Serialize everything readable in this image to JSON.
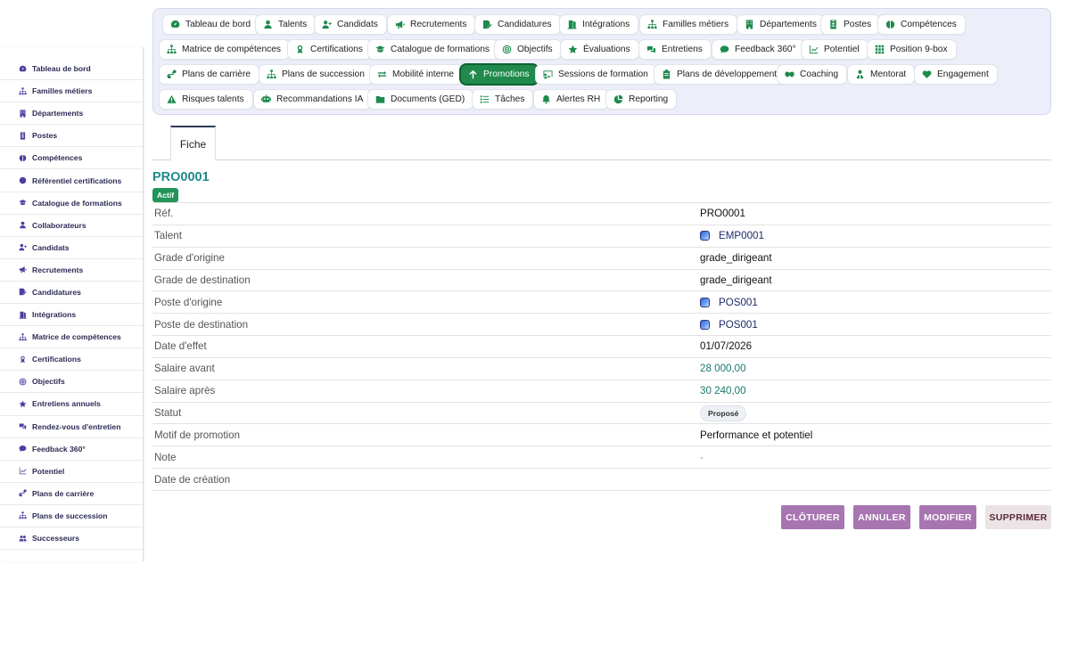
{
  "sidebar": {
    "items": [
      {
        "label": "Tableau de bord",
        "icon": "dashboard-icon"
      },
      {
        "label": "Familles métiers",
        "icon": "sitemap-icon"
      },
      {
        "label": "Départements",
        "icon": "building-icon"
      },
      {
        "label": "Postes",
        "icon": "id-badge-icon"
      },
      {
        "label": "Compétences",
        "icon": "brain-icon"
      },
      {
        "label": "Référentiel certifications",
        "icon": "certificate-icon"
      },
      {
        "label": "Catalogue de formations",
        "icon": "graduation-cap-icon"
      },
      {
        "label": "Collaborateurs",
        "icon": "user-icon"
      },
      {
        "label": "Candidats",
        "icon": "user-plus-icon"
      },
      {
        "label": "Recrutements",
        "icon": "megaphone-icon"
      },
      {
        "label": "Candidatures",
        "icon": "file-signature-icon"
      },
      {
        "label": "Intégrations",
        "icon": "door-icon"
      },
      {
        "label": "Matrice de compétences",
        "icon": "sitemap-icon"
      },
      {
        "label": "Certifications",
        "icon": "award-icon"
      },
      {
        "label": "Objectifs",
        "icon": "target-icon"
      },
      {
        "label": "Entretiens annuels",
        "icon": "star-icon"
      },
      {
        "label": "Rendez-vous d'entretien",
        "icon": "comments-icon"
      },
      {
        "label": "Feedback 360°",
        "icon": "comment-icon"
      },
      {
        "label": "Potentiel",
        "icon": "chart-line-icon"
      },
      {
        "label": "Plans de carrière",
        "icon": "route-icon"
      },
      {
        "label": "Plans de succession",
        "icon": "sitemap-icon"
      },
      {
        "label": "Successeurs",
        "icon": "users-icon"
      }
    ]
  },
  "topnav": {
    "chips": [
      {
        "label": "Tableau de bord",
        "icon": "dashboard-icon"
      },
      {
        "label": "Talents",
        "icon": "user-icon"
      },
      {
        "label": "Candidats",
        "icon": "user-plus-icon"
      },
      {
        "label": "Recrutements",
        "icon": "megaphone-icon"
      },
      {
        "label": "Candidatures",
        "icon": "file-signature-icon"
      },
      {
        "label": "Intégrations",
        "icon": "door-icon"
      },
      {
        "label": "Familles métiers",
        "icon": "sitemap-icon"
      },
      {
        "label": "Départements",
        "icon": "building-icon"
      },
      {
        "label": "Postes",
        "icon": "id-badge-icon"
      },
      {
        "label": "Compétences",
        "icon": "brain-icon"
      },
      {
        "label": "Matrice de compétences",
        "icon": "sitemap-icon"
      },
      {
        "label": "Certifications",
        "icon": "award-icon"
      },
      {
        "label": "Catalogue de formations",
        "icon": "graduation-cap-icon"
      },
      {
        "label": "Objectifs",
        "icon": "target-icon"
      },
      {
        "label": "Évaluations",
        "icon": "star-icon"
      },
      {
        "label": "Entretiens",
        "icon": "comments-icon"
      },
      {
        "label": "Feedback 360°",
        "icon": "comment-icon"
      },
      {
        "label": "Potentiel",
        "icon": "chart-line-icon"
      },
      {
        "label": "Position 9-box",
        "icon": "grid-icon"
      },
      {
        "label": "Plans de carrière",
        "icon": "route-icon"
      },
      {
        "label": "Plans de succession",
        "icon": "sitemap-icon"
      },
      {
        "label": "Mobilité interne",
        "icon": "exchange-icon"
      },
      {
        "label": "Promotions",
        "icon": "arrow-up-icon",
        "active": true
      },
      {
        "label": "Sessions de formation",
        "icon": "chalkboard-icon"
      },
      {
        "label": "Plans de développement",
        "icon": "clipboard-icon"
      },
      {
        "label": "Coaching",
        "icon": "handshake-icon"
      },
      {
        "label": "Mentorat",
        "icon": "mentor-icon"
      },
      {
        "label": "Engagement",
        "icon": "heart-icon"
      },
      {
        "label": "Risques talents",
        "icon": "warning-icon"
      },
      {
        "label": "Recommandations IA",
        "icon": "robot-icon"
      },
      {
        "label": "Documents (GED)",
        "icon": "folder-icon"
      },
      {
        "label": "Tâches",
        "icon": "tasks-icon"
      },
      {
        "label": "Alertes RH",
        "icon": "bell-icon"
      },
      {
        "label": "Reporting",
        "icon": "pie-chart-icon"
      }
    ]
  },
  "tabs": {
    "fiche": "Fiche"
  },
  "record": {
    "code": "PRO0001",
    "status_badge": "Actif",
    "fields": [
      {
        "label": "Réf.",
        "value": "PRO0001",
        "style": "plain"
      },
      {
        "label": "Talent",
        "value": "EMP0001",
        "style": "link"
      },
      {
        "label": "Grade d'origine",
        "value": "grade_dirigeant",
        "style": "plain"
      },
      {
        "label": "Grade de destination",
        "value": "grade_dirigeant",
        "style": "plain"
      },
      {
        "label": "Poste d'origine",
        "value": "POS001",
        "style": "link"
      },
      {
        "label": "Poste de destination",
        "value": "POS001",
        "style": "link"
      },
      {
        "label": "Date d'effet",
        "value": "01/07/2026",
        "style": "plain"
      },
      {
        "label": "Salaire avant",
        "value": "28 000,00",
        "style": "teal"
      },
      {
        "label": "Salaire après",
        "value": "30 240,00",
        "style": "teal"
      },
      {
        "label": "Statut",
        "value": "Proposé",
        "style": "pill"
      },
      {
        "label": "Motif de promotion",
        "value": "Performance et potentiel",
        "style": "plain"
      },
      {
        "label": "Note",
        "value": "-",
        "style": "muted"
      },
      {
        "label": "Date de création",
        "value": "",
        "style": "plain"
      }
    ]
  },
  "actions": {
    "cloturer": "CLÔTURER",
    "annuler": "ANNULER",
    "modifier": "MODIFIER",
    "supprimer": "SUPPRIMER"
  },
  "colors": {
    "accent_green": "#1f8a4c",
    "title_teal": "#1f8a8a",
    "button_purple": "#a775b0",
    "nav_panel": "#eceef9"
  }
}
